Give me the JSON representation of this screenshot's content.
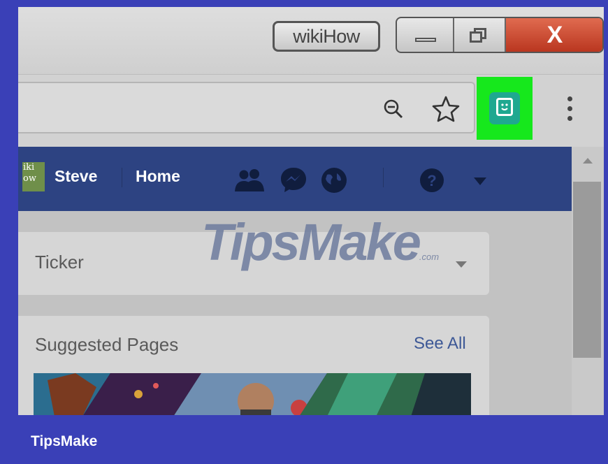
{
  "titlebar": {
    "profile_tab": "wikiHow",
    "minimize": "minimize",
    "restore": "restore",
    "close_glyph": "X"
  },
  "toolbar": {
    "zoom_icon": "zoom-out-icon",
    "bookmark_icon": "star-icon",
    "extension_icon": "bitmoji-extension-icon",
    "menu_icon": "kebab-menu-icon",
    "extension_highlight_color": "#16e81c"
  },
  "fbnav": {
    "avatar_text": [
      "iki",
      "ow"
    ],
    "user_name": "Steve",
    "home": "Home",
    "icons": [
      "friends-icon",
      "messenger-icon",
      "globe-icon",
      "help-icon",
      "dropdown-caret-icon"
    ],
    "bar_color": "#2d4382"
  },
  "ticker": {
    "title": "Ticker"
  },
  "suggested": {
    "title": "Suggested Pages",
    "see_all": "See All"
  },
  "watermark": {
    "text": "TipsMake",
    "suffix": ".com"
  },
  "footer": {
    "brand": "TipsMake"
  }
}
